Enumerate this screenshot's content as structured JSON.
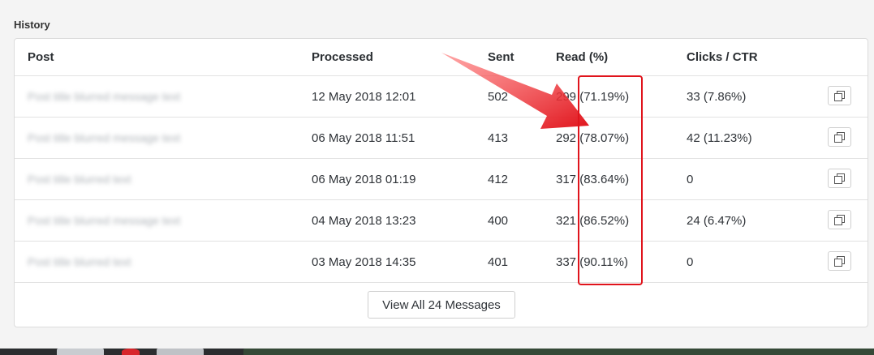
{
  "section_title": "History",
  "table": {
    "headers": {
      "post": "Post",
      "processed": "Processed",
      "sent": "Sent",
      "read": "Read (%)",
      "clicks": "Clicks / CTR"
    },
    "rows": [
      {
        "post": "Post title blurred message text",
        "processed": "12 May 2018 12:01",
        "sent": "502",
        "read": "299 (71.19%)",
        "clicks": "33 (7.86%)"
      },
      {
        "post": "Post title blurred message text",
        "processed": "06 May 2018 11:51",
        "sent": "413",
        "read": "292 (78.07%)",
        "clicks": "42 (11.23%)"
      },
      {
        "post": "Post title blurred text",
        "processed": "06 May 2018 01:19",
        "sent": "412",
        "read": "317 (83.64%)",
        "clicks": "0"
      },
      {
        "post": "Post title blurred message text",
        "processed": "04 May 2018 13:23",
        "sent": "400",
        "read": "321 (86.52%)",
        "clicks": "24 (6.47%)"
      },
      {
        "post": "Post title blurred text",
        "processed": "03 May 2018 14:35",
        "sent": "401",
        "read": "337 (90.11%)",
        "clicks": "0"
      }
    ]
  },
  "view_all_label": "View All 24 Messages",
  "colors": {
    "annotation_red": "#e0141c",
    "border": "#dcdcdc",
    "background": "#f4f4f4"
  },
  "icons": {
    "row_action": "copy-icon",
    "annotation": "red-arrow"
  }
}
